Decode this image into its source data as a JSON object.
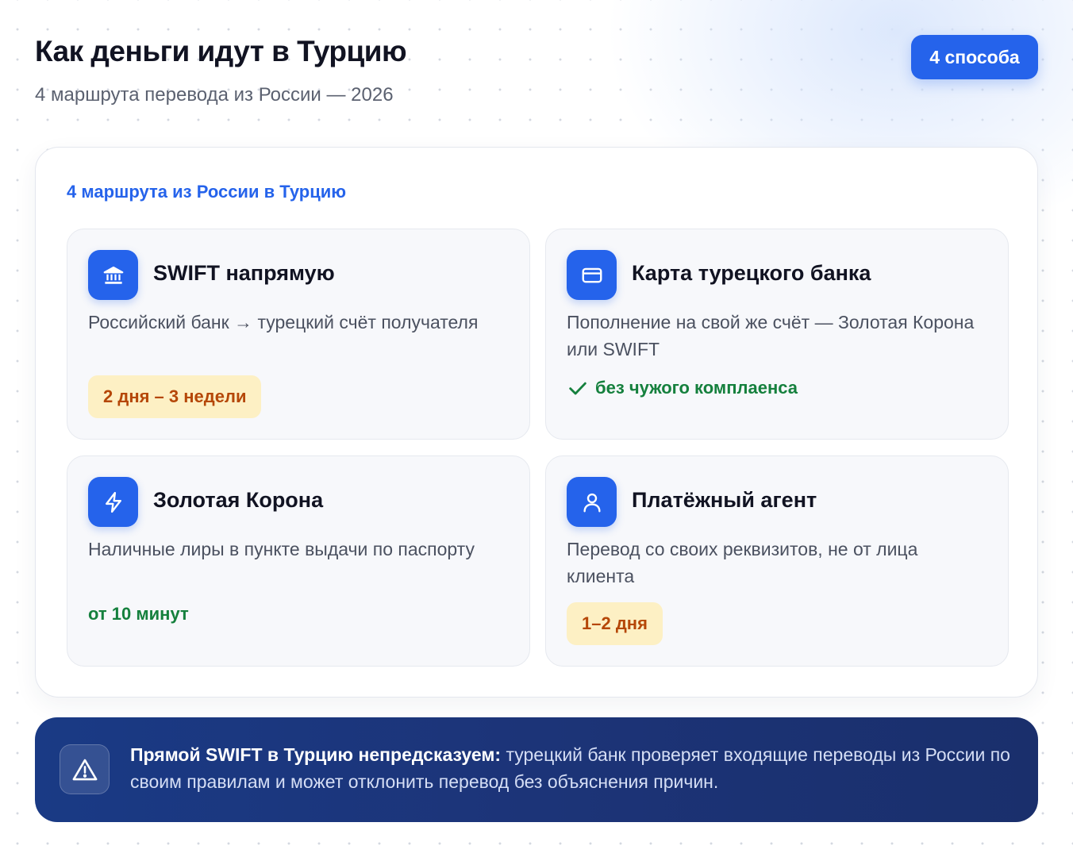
{
  "header": {
    "title": "Как деньги идут в Турцию",
    "subtitle": "4 маршрута перевода из России — 2026",
    "badge": "4 способа"
  },
  "card": {
    "heading": "4 маршрута из России в Турцию",
    "routes": [
      {
        "icon": "bank-icon",
        "title": "SWIFT напрямую",
        "description": "Российский банк → турецкий счёт получателя",
        "tag": "2 дня – 3 недели",
        "tag_style": "warning"
      },
      {
        "icon": "card-icon",
        "title": "Карта турецкого банка",
        "description": "Пополнение на свой же счёт — Золотая Корона или SWIFT",
        "tag": "без чужого комплаенса",
        "tag_style": "success-check"
      },
      {
        "icon": "lightning-icon",
        "title": "Золотая Корона",
        "description": "Наличные лиры в пункте выдачи по паспорту",
        "tag": "от 10 минут",
        "tag_style": "success"
      },
      {
        "icon": "user-icon",
        "title": "Платёжный агент",
        "description": "Перевод со своих реквизитов, не от лица клиента",
        "tag": "1–2 дня",
        "tag_style": "warning"
      }
    ]
  },
  "notice": {
    "icon": "warning-icon",
    "bold": "Прямой SWIFT в Турцию непредсказуем:",
    "text": " турецкий банк проверяет входящие переводы из России по своим правилам и может отклонить перевод без объяснения причин."
  },
  "colors": {
    "accent": "#2563eb",
    "warning_bg": "#fdf0c4",
    "warning_text": "#b54708",
    "success_text": "#15803d",
    "notice_bg": "#1c3478"
  }
}
